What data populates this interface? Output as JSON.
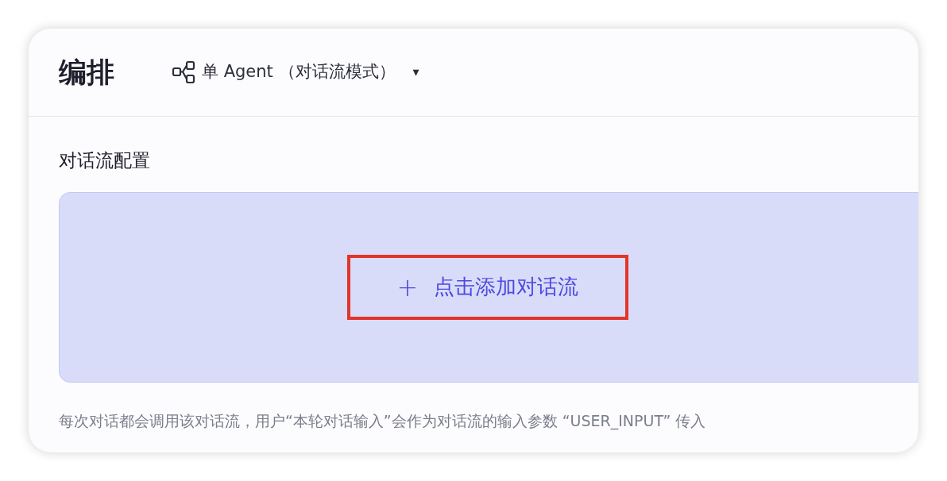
{
  "header": {
    "title": "编排",
    "mode_dropdown": {
      "label": "单 Agent （对话流模式）",
      "caret": "▾"
    }
  },
  "section": {
    "title": "对话流配置",
    "dropzone": {
      "add_button": {
        "icon": "+",
        "label": "点击添加对话流",
        "highlighted": true
      }
    },
    "hint": "每次对话都会调用该对话流，用户“本轮对话输入”会作为对话流的输入参数 “USER_INPUT” 传入"
  }
}
